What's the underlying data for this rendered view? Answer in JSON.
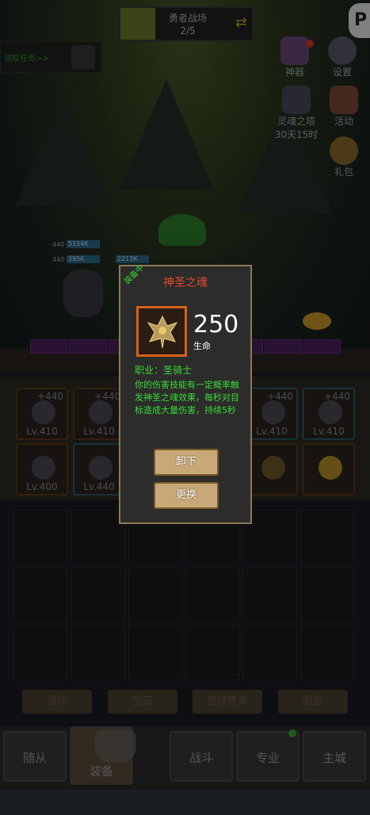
{
  "arena": {
    "title": "勇者战场",
    "progress": "2/5"
  },
  "quest": {
    "label": "领取任务>>"
  },
  "side": {
    "artifact": "神器",
    "settings": "设置",
    "tower_name": "灵魂之塔",
    "tower_timer": "30天15时",
    "activity": "活动",
    "gift": "礼包"
  },
  "hp": {
    "level": "440",
    "bars": [
      "5154K",
      "395K",
      "2213K"
    ]
  },
  "equip_slots": [
    {
      "plus": "+440",
      "level": "Lv.410"
    },
    {
      "plus": "+440",
      "level": "Lv.410"
    },
    {
      "plus": "+440",
      "level": "Lv.410"
    },
    {
      "plus": "+440",
      "level": "Lv.410"
    },
    {
      "plus": "",
      "level": "Lv.400"
    },
    {
      "plus": "",
      "level": "Lv.440"
    },
    {
      "plus": "",
      "level": ""
    },
    {
      "plus": "",
      "level": ""
    }
  ],
  "subtabs": [
    "强化",
    "宝石",
    "整理售卖",
    "图鉴"
  ],
  "nav": [
    "随从",
    "装备",
    "战斗",
    "专业",
    "主城"
  ],
  "popup": {
    "ribbon": "装备中",
    "title": "神圣之魂",
    "stat_value": "250",
    "stat_label": "生命",
    "job": "职业：圣骑士",
    "description": "你的伤害技能有一定概率触发神圣之魂效果，每秒对目标造成大量伤害，持续5秒",
    "btn_unequip": "卸下",
    "btn_replace": "更换"
  },
  "colors": {
    "title_red": "#e04a2a",
    "desc_green": "#3ad83a",
    "rare_orange": "#d8601a"
  }
}
